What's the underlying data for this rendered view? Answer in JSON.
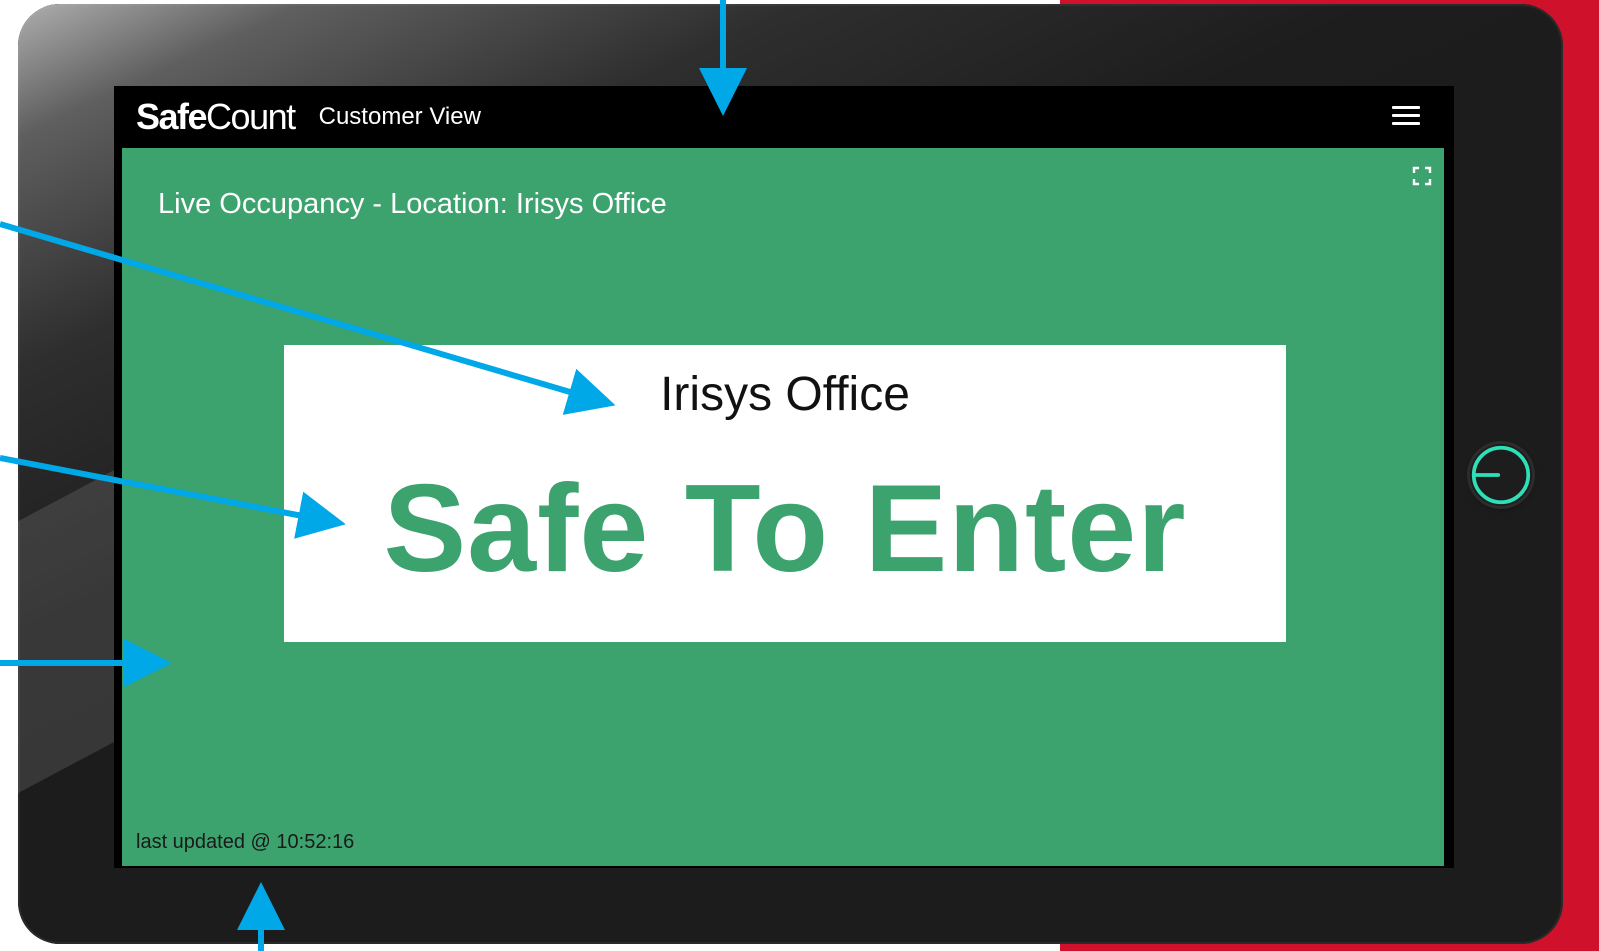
{
  "app": {
    "brand_bold": "Safe",
    "brand_light": "Count",
    "view_label": "Customer View"
  },
  "header": {
    "menu_icon": "hamburger-menu-icon",
    "fullscreen_icon": "fullscreen-icon"
  },
  "main": {
    "heading": "Live Occupancy - Location: Irisys Office",
    "card": {
      "location_name": "Irisys Office",
      "status": "Safe To Enter"
    },
    "footer": {
      "last_updated": "last updated @ 10:52:16"
    }
  },
  "colors": {
    "occupancy_safe_green": "#3ca36e",
    "annotation_arrow": "#00a8e8",
    "accent_red": "#d0112b",
    "power_ring": "#2de0b8"
  }
}
